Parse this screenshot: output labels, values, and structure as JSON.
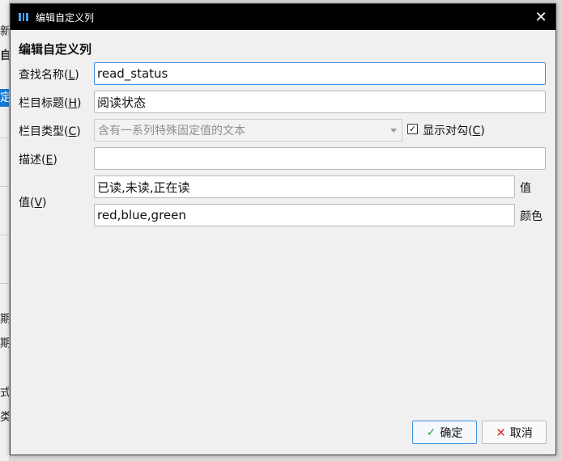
{
  "background": {
    "fragments": [
      "新",
      "自",
      "定",
      "期",
      "期",
      "式",
      "类"
    ]
  },
  "dialog": {
    "title": "编辑自定义列",
    "close_symbol": "✕",
    "heading": "编辑自定义列"
  },
  "form": {
    "lookup_name": {
      "label": "查找名称(",
      "key": "L",
      "suffix": ")",
      "value": "read_status"
    },
    "column_heading": {
      "label": "栏目标题(",
      "key": "H",
      "suffix": ")",
      "value": "阅读状态"
    },
    "column_type": {
      "label": "栏目类型(",
      "key": "C",
      "suffix": ")",
      "value": "含有一系列特殊固定值的文本"
    },
    "show_checkmark": {
      "check": "✓",
      "label": "显示对勾(",
      "key": "C",
      "suffix": ")",
      "checked": true
    },
    "description": {
      "label": "描述(",
      "key": "E",
      "suffix": ")",
      "value": ""
    },
    "values": {
      "label": "值(",
      "key": "V",
      "suffix": ")",
      "value": "已读,未读,正在读",
      "side_label": "值"
    },
    "colors": {
      "value": "red,blue,green",
      "side_label": "颜色"
    }
  },
  "buttons": {
    "ok": {
      "icon": "✓",
      "label": "确定"
    },
    "cancel": {
      "icon": "✕",
      "label": "取消"
    }
  },
  "colors": {
    "accent": "#3d8fe0",
    "titlebar": "#000000",
    "ok_icon": "#2a9d3a",
    "cancel_icon": "#d8322b"
  }
}
